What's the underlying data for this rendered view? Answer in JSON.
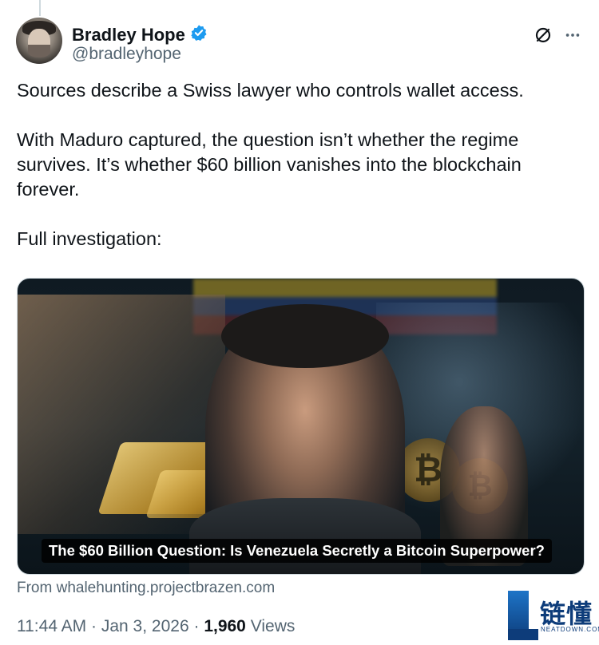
{
  "author": {
    "name": "Bradley Hope",
    "handle": "@bradleyhope",
    "verified": true
  },
  "actions": {
    "grok_icon": "slash-circle-icon",
    "more_icon": "more-dots-icon"
  },
  "tweet": {
    "paragraphs": [
      "Sources describe a Swiss lawyer who controls wallet access.",
      "With Maduro captured, the question isn’t whether the regime survives. It’s whether $60 billion vanishes into the blockchain forever.",
      "Full investigation:"
    ]
  },
  "card": {
    "title": "The $60 Billion Question: Is Venezuela Secretly a Bitcoin Superpower?",
    "source": "From whalehunting.projectbrazen.com"
  },
  "meta": {
    "time": "11:44 AM",
    "separator": "·",
    "date": "Jan 3, 2026",
    "views_count": "1,960",
    "views_label": "Views"
  },
  "watermark": {
    "cn": "链懂",
    "site": "NEATDOWN.COM"
  },
  "colors": {
    "text": "#0f1419",
    "secondary": "#536471",
    "verified": "#1d9bf0",
    "border": "#cfd9de"
  }
}
